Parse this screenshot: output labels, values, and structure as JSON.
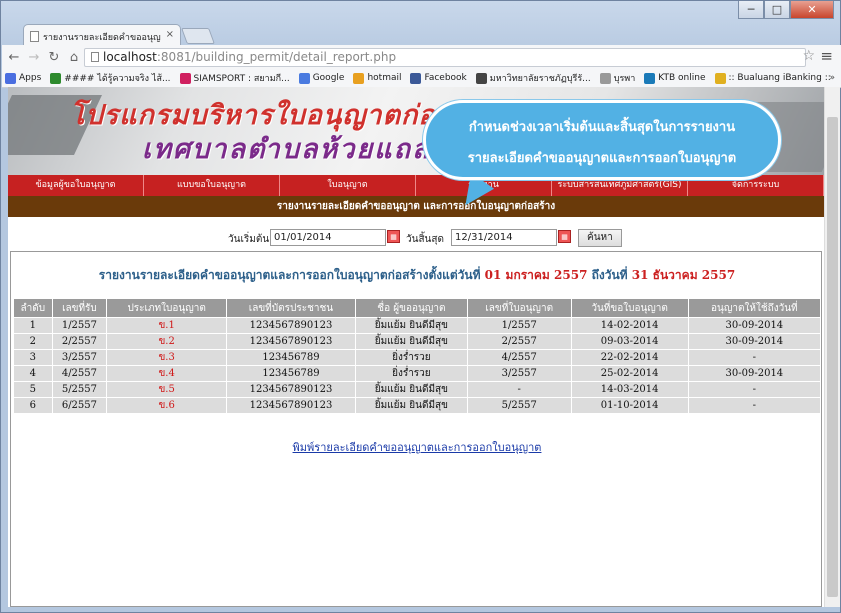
{
  "browser": {
    "tab_title": "รายงานรายละเอียดคำขออนุญ",
    "tab_close": "×",
    "url_host": "localhost",
    "url_rest": ":8081/building_permit/detail_report.php",
    "window_min": "─",
    "window_max": "□",
    "window_close": "✕",
    "bookmarks": [
      {
        "label": "Apps",
        "icon": "apps-icon",
        "color": "#4a6ee0"
      },
      {
        "label": "#### ได้รู้ความจริง ไส้...",
        "icon": "bookmark-icon",
        "color": "#2d8a2d"
      },
      {
        "label": "SIAMSPORT : สยามกี...",
        "icon": "siamsport-icon",
        "color": "#d02060"
      },
      {
        "label": "Google",
        "icon": "google-icon",
        "color": "#4a7be0"
      },
      {
        "label": "hotmail",
        "icon": "hotmail-icon",
        "color": "#e8a020"
      },
      {
        "label": "Facebook",
        "icon": "facebook-icon",
        "color": "#3b5998"
      },
      {
        "label": "มหาวิทยาลัยราชภัฏบุรีรั...",
        "icon": "university-icon",
        "color": "#444"
      },
      {
        "label": "บุรพา",
        "icon": "page-icon",
        "color": "#999"
      },
      {
        "label": "KTB online",
        "icon": "ktb-icon",
        "color": "#1a7ab8"
      },
      {
        "label": ":: Bualuang iBanking ::",
        "icon": "bualuang-icon",
        "color": "#e0b020"
      }
    ],
    "more_bookmarks": "»"
  },
  "header": {
    "title_line1": "โปรแกรมบริหารใบอนุญาตก่อสร้าง",
    "title_line2": "เทศบาลตำบลห้วยแถลง"
  },
  "nav_menu": [
    "ข้อมูลผู้ขอใบอนุญาต",
    "แบบขอใบอนุญาต",
    "ใบอนุญาต",
    "รายงาน",
    "ระบบสารสนเทศภูมิศาสตร์(GIS)",
    "จัดการระบบ"
  ],
  "subheader": "รายงานรายละเอียดคำขออนุญาต และการออกใบอนุญาตก่อสร้าง",
  "filter": {
    "start_label": "วันเริ่มต้น",
    "start_value": "01/01/2014",
    "end_label": "วันสิ้นสุด",
    "end_value": "12/31/2014",
    "search_label": "ค้นหา"
  },
  "report": {
    "title_prefix": "รายงานรายละเอียดคำขออนุญาตและการออกใบอนุญาตก่อสร้างตั้งแต่วันที่",
    "date_from": "01 มกราคม 2557",
    "to_text": "ถึงวันที่",
    "date_to": "31 ธันวาคม 2557",
    "columns": [
      "ลำดับ",
      "เลขที่รับ",
      "ประเภทใบอนุญาต",
      "เลขที่บัตรประชาชน",
      "ชื่อ ผู้ขออนุญาต",
      "เลขที่ใบอนุญาต",
      "วันที่ขอใบอนุญาต",
      "อนุญาตให้ใช้ถึงวันที่"
    ],
    "rows": [
      [
        "1",
        "1/2557",
        "ข.1",
        "1234567890123",
        "ยิ้มแย้ม ยินดีมีสุข",
        "1/2557",
        "14-02-2014",
        "30-09-2014"
      ],
      [
        "2",
        "2/2557",
        "ข.2",
        "1234567890123",
        "ยิ้มแย้ม ยินดีมีสุข",
        "2/2557",
        "09-03-2014",
        "30-09-2014"
      ],
      [
        "3",
        "3/2557",
        "ข.3",
        "123456789",
        "ยิ่งร่ำรวย",
        "4/2557",
        "22-02-2014",
        "-"
      ],
      [
        "4",
        "4/2557",
        "ข.4",
        "123456789",
        "ยิ่งร่ำรวย",
        "3/2557",
        "25-02-2014",
        "30-09-2014"
      ],
      [
        "5",
        "5/2557",
        "ข.5",
        "1234567890123",
        "ยิ้มแย้ม ยินดีมีสุข",
        "-",
        "14-03-2014",
        "-"
      ],
      [
        "6",
        "6/2557",
        "ข.6",
        "1234567890123",
        "ยิ้มแย้ม ยินดีมีสุข",
        "5/2557",
        "01-10-2014",
        "-"
      ]
    ],
    "print_link": "พิมพ์รายละเอียดคำขออนุญาตและการออกใบอนุญาต"
  },
  "callout": {
    "line1": "กำหนดช่วงเวลาเริ่มต้นและสิ้นสุดในการรายงาน",
    "line2": "รายละเอียดคำขออนุญาตและการออกใบอนุญาต"
  }
}
